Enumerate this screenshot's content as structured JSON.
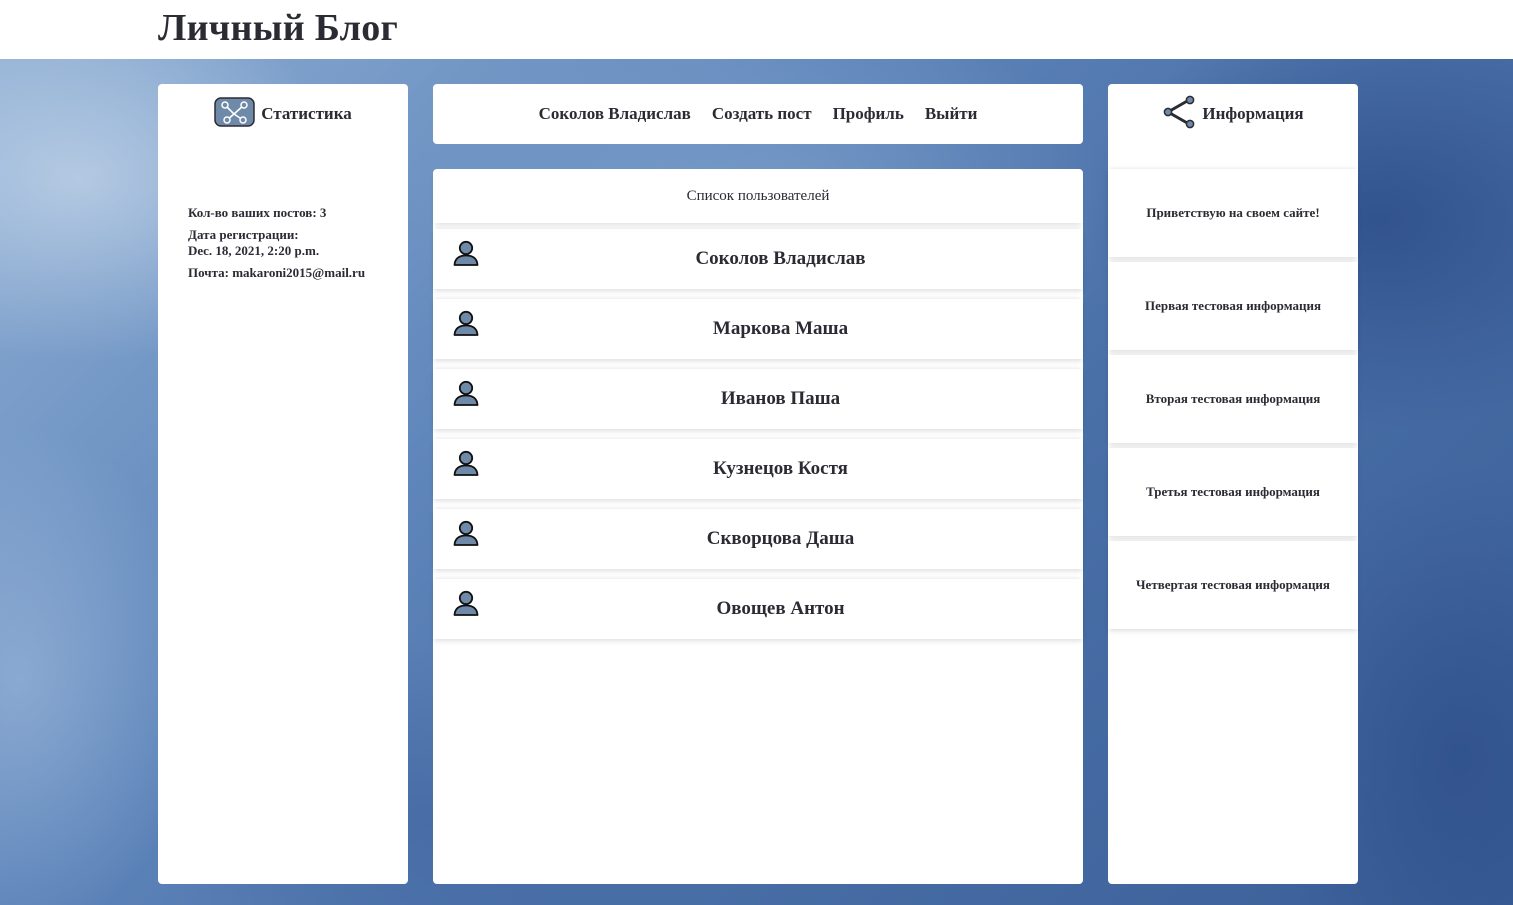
{
  "site": {
    "title": "Личный Блог"
  },
  "stats_panel": {
    "title": "Статистика",
    "icon": "network-icon",
    "posts_count": "Кол-во ваших постов: 3",
    "reg_label": "Дата регистрации:",
    "reg_date": "Dec. 18, 2021, 2:20 p.m.",
    "email": "Почта: makaroni2015@mail.ru"
  },
  "nav": {
    "username": "Соколов Владислав",
    "create_post": "Создать пост",
    "profile": "Профиль",
    "logout": "Выйти"
  },
  "users": {
    "title": "Список пользователей",
    "icon": "user-icon",
    "items": [
      {
        "name": "Соколов Владислав"
      },
      {
        "name": "Маркова Маша"
      },
      {
        "name": "Иванов Паша"
      },
      {
        "name": "Кузнецов Костя"
      },
      {
        "name": "Скворцова Даша"
      },
      {
        "name": "Овощев Антон"
      }
    ]
  },
  "info_panel": {
    "title": "Информация",
    "icon": "share-icon",
    "items": [
      {
        "text": "Приветствую на своем сайте!"
      },
      {
        "text": "Первая тестовая информация"
      },
      {
        "text": "Вторая тестовая информация"
      },
      {
        "text": "Третья тестовая информация"
      },
      {
        "text": "Четвертая тестовая информация"
      }
    ]
  },
  "colors": {
    "text": "#2b2b33",
    "icon_fill": "#6e8aa8",
    "panel_bg": "#ffffff",
    "background": "#4a70a8"
  }
}
